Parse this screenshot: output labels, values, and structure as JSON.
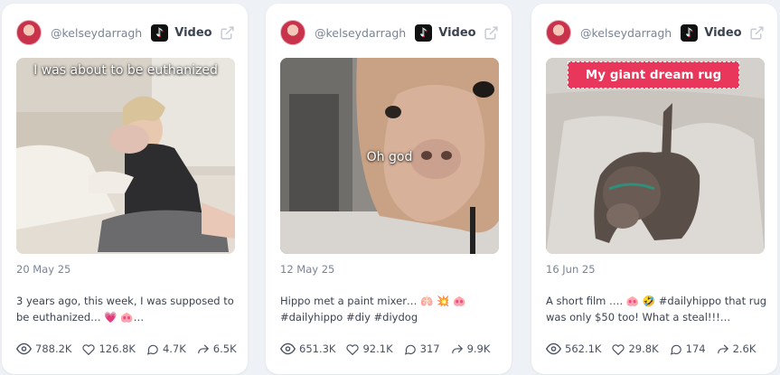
{
  "cards": [
    {
      "username": "@kelseydarragh",
      "platform_icon": "tiktok-icon",
      "type_label": "Video",
      "overlay_text": "I was about to be euthanized",
      "date": "20 May 25",
      "description_line1": "3 years ago, this week, I was supposed to",
      "description_line2": "be euthanized… 💗 🐽…",
      "views": "788.2K",
      "likes": "126.8K",
      "comments": "4.7K",
      "shares": "6.5K"
    },
    {
      "username": "@kelseydarragh",
      "platform_icon": "tiktok-icon",
      "type_label": "Video",
      "overlay_text": "Oh god",
      "date": "12 May 25",
      "description_line1": "Hippo met a paint mixer… 🫁 💥 🐽",
      "description_line2": "#dailyhippo #diy #diydog",
      "views": "651.3K",
      "likes": "92.1K",
      "comments": "317",
      "shares": "9.9K"
    },
    {
      "username": "@kelseydarragh",
      "platform_icon": "tiktok-icon",
      "type_label": "Video",
      "overlay_text": "My giant dream rug",
      "date": "16 Jun 25",
      "description_line1": "A short film …. 🐽 🤣 #dailyhippo that rug",
      "description_line2": "was only $50 too! What a steal!!!…",
      "views": "562.1K",
      "likes": "29.8K",
      "comments": "174",
      "shares": "2.6K"
    }
  ],
  "colors": {
    "background": "#eef1f5",
    "card": "#ffffff",
    "rug_banner": "#e8375a"
  }
}
